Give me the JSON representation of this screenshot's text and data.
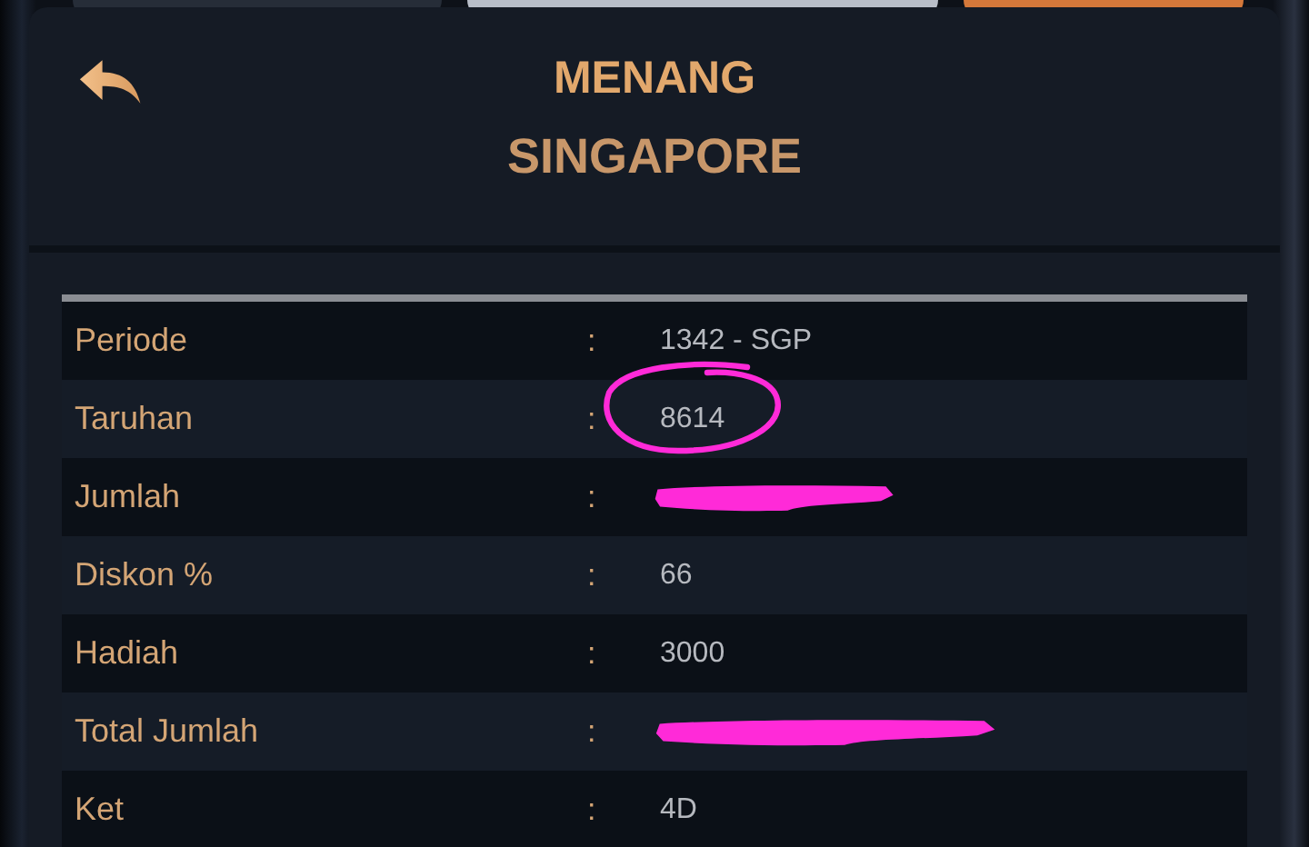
{
  "dialog": {
    "title": "MENANG",
    "subtitle": "SINGAPORE"
  },
  "rows": [
    {
      "kind": "plain",
      "label": "Periode",
      "separator": ":",
      "value": "1342 - SGP"
    },
    {
      "kind": "circled",
      "label": "Taruhan",
      "separator": ":",
      "value": "8614"
    },
    {
      "kind": "redacted",
      "label": "Jumlah",
      "separator": ":"
    },
    {
      "kind": "plain",
      "label": "Diskon %",
      "separator": ":",
      "value": "66"
    },
    {
      "kind": "plain",
      "label": "Hadiah",
      "separator": ":",
      "value": "3000"
    },
    {
      "kind": "redacted",
      "label": "Total Jumlah",
      "separator": ":"
    },
    {
      "kind": "plain",
      "label": "Ket",
      "separator": ":",
      "value": "4D"
    }
  ]
}
